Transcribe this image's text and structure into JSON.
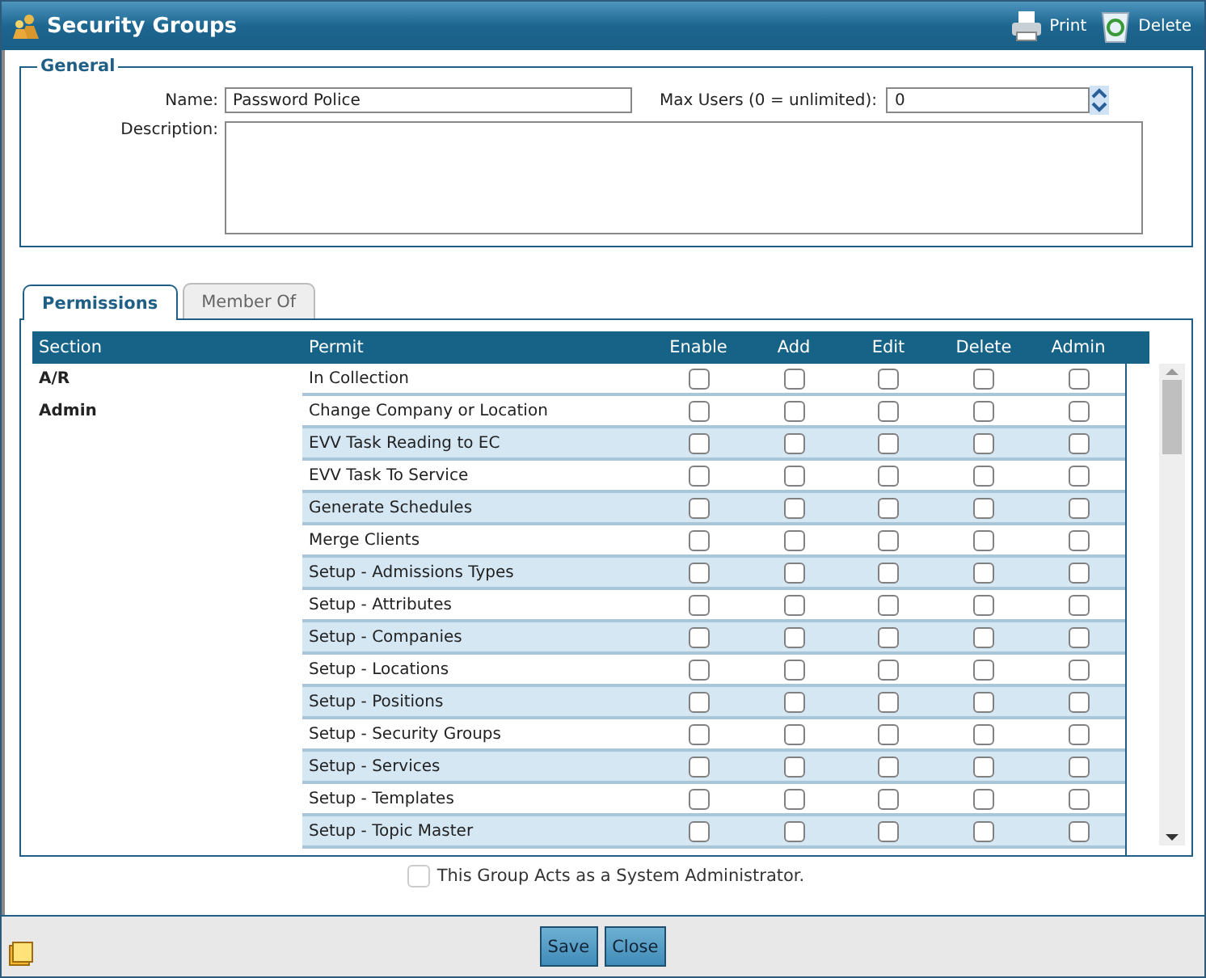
{
  "window": {
    "title": "Security Groups",
    "actions": [
      "Print",
      "Delete"
    ]
  },
  "general": {
    "legend": "General",
    "name_label": "Name:",
    "name_value": "Password Police",
    "max_label": "Max Users (0 = unlimited):",
    "max_value": "0",
    "description_label": "Description:"
  },
  "tabs": [
    {
      "label": "Permissions",
      "selected": true
    },
    {
      "label": "Member Of",
      "selected": false
    }
  ],
  "table": {
    "columns": [
      "Section",
      "Permit",
      "Enable",
      "Add",
      "Edit",
      "Delete",
      "Admin"
    ],
    "sections": [
      {
        "name": "A/R",
        "permits": [
          {
            "name": "In Collection",
            "enable": false,
            "add": false,
            "edit": false,
            "delete": false,
            "admin": false
          }
        ]
      },
      {
        "name": "Admin",
        "permits": [
          {
            "name": "Change Company or Location",
            "enable": false,
            "add": false,
            "edit": false,
            "delete": false,
            "admin": false
          },
          {
            "name": "EVV Task Reading to EC",
            "enable": false,
            "add": false,
            "edit": false,
            "delete": false,
            "admin": false
          },
          {
            "name": "EVV Task To Service",
            "enable": false,
            "add": false,
            "edit": false,
            "delete": false,
            "admin": false
          },
          {
            "name": "Generate Schedules",
            "enable": false,
            "add": false,
            "edit": false,
            "delete": false,
            "admin": false
          },
          {
            "name": "Merge Clients",
            "enable": false,
            "add": false,
            "edit": false,
            "delete": false,
            "admin": false
          },
          {
            "name": "Setup - Admissions Types",
            "enable": false,
            "add": false,
            "edit": false,
            "delete": false,
            "admin": false
          },
          {
            "name": "Setup - Attributes",
            "enable": false,
            "add": false,
            "edit": false,
            "delete": false,
            "admin": false
          },
          {
            "name": "Setup - Companies",
            "enable": false,
            "add": false,
            "edit": false,
            "delete": false,
            "admin": false
          },
          {
            "name": "Setup - Locations",
            "enable": false,
            "add": false,
            "edit": false,
            "delete": false,
            "admin": false
          },
          {
            "name": "Setup - Positions",
            "enable": false,
            "add": false,
            "edit": false,
            "delete": false,
            "admin": false
          },
          {
            "name": "Setup - Security Groups",
            "enable": false,
            "add": false,
            "edit": false,
            "delete": false,
            "admin": false
          },
          {
            "name": "Setup - Services",
            "enable": false,
            "add": false,
            "edit": false,
            "delete": false,
            "admin": false
          },
          {
            "name": "Setup - Templates",
            "enable": false,
            "add": false,
            "edit": false,
            "delete": false,
            "admin": false
          },
          {
            "name": "Setup - Topic Master",
            "enable": false,
            "add": false,
            "edit": false,
            "delete": false,
            "admin": false
          }
        ]
      }
    ]
  },
  "system_admin": {
    "label": "This Group Acts as a System Administrator.",
    "checked": false,
    "disabled": true
  },
  "buttons": [
    "Save",
    "Close"
  ]
}
